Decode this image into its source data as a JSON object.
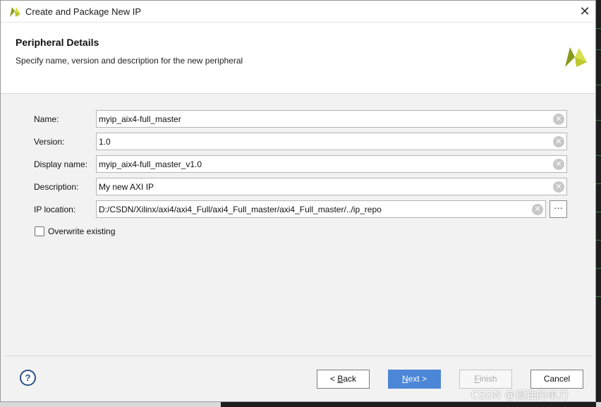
{
  "window": {
    "title": "Create and Package New IP",
    "close_glyph": "✕"
  },
  "header": {
    "title": "Peripheral Details",
    "subtitle": "Specify name, version and description for the new peripheral"
  },
  "form": {
    "name": {
      "label": "Name:",
      "value": "myip_aix4-full_master"
    },
    "version": {
      "label": "Version:",
      "value": "1.0"
    },
    "display_name": {
      "label": "Display name:",
      "value": "myip_aix4-full_master_v1.0"
    },
    "description": {
      "label": "Description:",
      "value": "My new AXI IP"
    },
    "ip_location": {
      "label": "IP location:",
      "value": "D:/CSDN/Xilinx/axi4/axi4_Full/axi4_Full_master/axi4_Full_master/../ip_repo"
    },
    "browse_label": "···",
    "overwrite": {
      "label": "Overwrite existing",
      "checked": false
    }
  },
  "buttons": {
    "help": "?",
    "back": {
      "prefix": "< ",
      "mnemonic": "B",
      "rest": "ack"
    },
    "next": {
      "mnemonic": "N",
      "rest": "ext >"
    },
    "finish": {
      "mnemonic": "F",
      "rest": "inish"
    },
    "cancel": "Cancel"
  },
  "watermark": "CSDN @孤独的单刀",
  "colors": {
    "primary_button": "#4c86d6",
    "help_icon": "#2a4f86",
    "xilinx_logo_light": "#d6e04a",
    "xilinx_logo_dark": "#8a9a1a"
  },
  "icons": {
    "title_logo": "xilinx-vivado-logo",
    "header_logo": "xilinx-vivado-logo",
    "clear": "clear-circle-icon",
    "close": "close-icon"
  }
}
